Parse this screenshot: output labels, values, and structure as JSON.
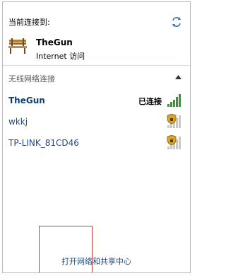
{
  "header": {
    "connected_to": "当前连接到:"
  },
  "current": {
    "name": "TheGun",
    "status": "Internet 访问"
  },
  "wireless": {
    "section_title": "无线网络连接",
    "networks": [
      {
        "name": "TheGun",
        "status": "已连接",
        "secured": false,
        "signal_bars": 5
      },
      {
        "name": "wkkj",
        "status": "",
        "secured": true,
        "signal_bars": 5
      },
      {
        "name": "TP-LINK_81CD46",
        "status": "",
        "secured": true,
        "signal_bars": 5
      }
    ]
  },
  "footer": {
    "link": "打开网络和共享中心"
  },
  "colors": {
    "link": "#1e4a8a",
    "signal_active": "#2e9d2e",
    "signal_inactive": "#c8c8c8",
    "highlight": "#c23a3a"
  }
}
